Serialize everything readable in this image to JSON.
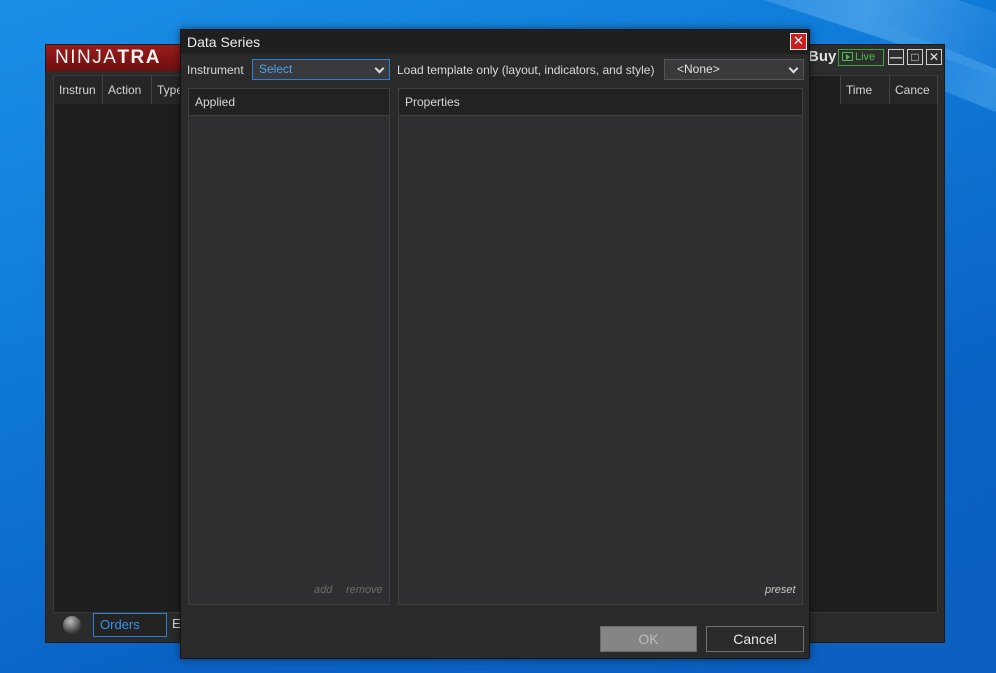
{
  "app": {
    "logo_light": "NINJA",
    "logo_bold": "TRA",
    "buy_label": "Buy",
    "live_label": "Live",
    "columns": [
      "Instrun",
      "Action",
      "Type",
      "Time",
      "Cance"
    ],
    "bottom_tabs": [
      "Orders",
      "E"
    ]
  },
  "dialog": {
    "title": "Data Series",
    "close_glyph": "✕",
    "instrument_label": "Instrument",
    "instrument_value": "Select",
    "template_label": "Load template only (layout, indicators, and style)",
    "template_value": "<None>",
    "applied_header": "Applied",
    "properties_header": "Properties",
    "add_label": "add",
    "remove_label": "remove",
    "preset_label": "preset",
    "ok_label": "OK",
    "cancel_label": "Cancel"
  },
  "colors": {
    "desktop": "#0f7ad8",
    "logo_red": "#9a1c1c",
    "accent_blue": "#2d7fd4",
    "live_green": "#4dbb4d",
    "close_red": "#cc2020"
  }
}
